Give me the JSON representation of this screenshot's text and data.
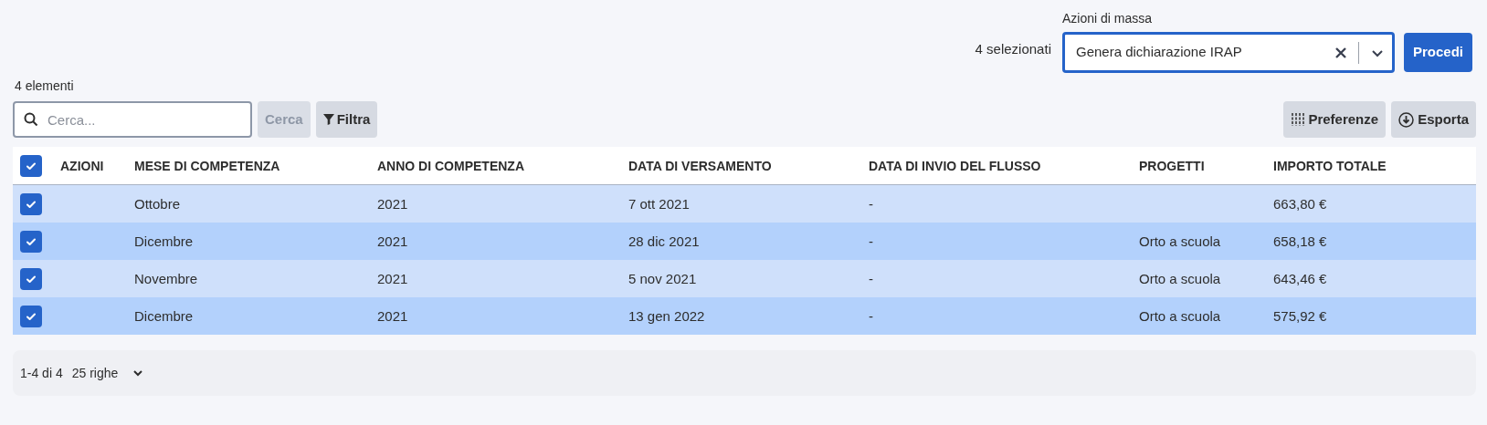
{
  "bulk_actions": {
    "selected_count": "4 selezionati",
    "label": "Azioni di massa",
    "value": "Genera dichiarazione IRAP",
    "button": "Procedi"
  },
  "item_count": "4 elementi",
  "search": {
    "placeholder": "Cerca...",
    "button": "Cerca",
    "filter_button": "Filtra"
  },
  "toolbar": {
    "preferences": "Preferenze",
    "export": "Esporta"
  },
  "table": {
    "all_checked": true,
    "columns": [
      "AZIONI",
      "MESE DI COMPETENZA",
      "ANNO DI COMPETENZA",
      "DATA DI VERSAMENTO",
      "DATA DI INVIO DEL FLUSSO",
      "PROGETTI",
      "IMPORTO TOTALE"
    ],
    "rows": [
      {
        "selected": true,
        "cells": [
          "",
          "Ottobre",
          "2021",
          "7 ott 2021",
          "-",
          "",
          "663,80 €"
        ]
      },
      {
        "selected": true,
        "cells": [
          "",
          "Dicembre",
          "2021",
          "28 dic 2021",
          "-",
          "Orto a scuola",
          "658,18 €"
        ]
      },
      {
        "selected": true,
        "cells": [
          "",
          "Novembre",
          "2021",
          "5 nov 2021",
          "-",
          "Orto a scuola",
          "643,46 €"
        ]
      },
      {
        "selected": true,
        "cells": [
          "",
          "Dicembre",
          "2021",
          "13 gen 2022",
          "-",
          "Orto a scuola",
          "575,92 €"
        ]
      }
    ]
  },
  "pagination": {
    "range": "1-4 di 4",
    "rows_per_page": "25 righe"
  }
}
